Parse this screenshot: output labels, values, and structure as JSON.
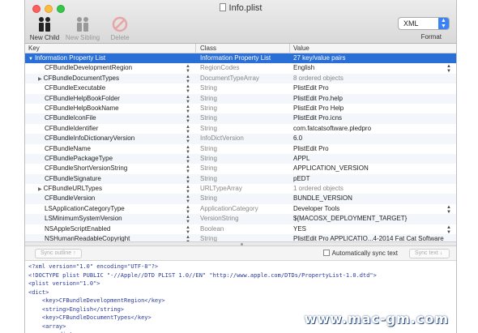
{
  "window": {
    "title": "Info.plist"
  },
  "toolbar": {
    "new_child": "New Child",
    "new_sibling": "New Sibling",
    "delete": "Delete",
    "format_value": "XML",
    "format_label": "Format"
  },
  "columns": {
    "key": "Key",
    "class": "Class",
    "value": "Value"
  },
  "rows": [
    {
      "key": "Information Property List",
      "class": "Information Property List",
      "value": "27 key/value pairs",
      "disclosure": "open",
      "selected": true
    },
    {
      "key": "CFBundleDevelopmentRegion",
      "class": "RegionCodes",
      "value": "English",
      "value_popup": true
    },
    {
      "key": "CFBundleDocumentTypes",
      "class": "DocumentTypeArray",
      "value": "8 ordered objects",
      "disclosure": "closed",
      "muted": true
    },
    {
      "key": "CFBundleExecutable",
      "class": "String",
      "value": "PlistEdit Pro"
    },
    {
      "key": "CFBundleHelpBookFolder",
      "class": "String",
      "value": "PlistEdit Pro.help"
    },
    {
      "key": "CFBundleHelpBookName",
      "class": "String",
      "value": "PlistEdit Pro Help"
    },
    {
      "key": "CFBundleIconFile",
      "class": "String",
      "value": "PlistEdit Pro.icns"
    },
    {
      "key": "CFBundleIdentifier",
      "class": "String",
      "value": "com.fatcatsoftware.pledpro"
    },
    {
      "key": "CFBundleInfoDictionaryVersion",
      "class": "InfoDictVersion",
      "value": "6.0"
    },
    {
      "key": "CFBundleName",
      "class": "String",
      "value": "PlistEdit Pro"
    },
    {
      "key": "CFBundlePackageType",
      "class": "String",
      "value": "APPL"
    },
    {
      "key": "CFBundleShortVersionString",
      "class": "String",
      "value": "APPLICATION_VERSION"
    },
    {
      "key": "CFBundleSignature",
      "class": "String",
      "value": "pEDT"
    },
    {
      "key": "CFBundleURLTypes",
      "class": "URLTypeArray",
      "value": "1 ordered objects",
      "disclosure": "closed",
      "muted": true
    },
    {
      "key": "CFBundleVersion",
      "class": "String",
      "value": "BUNDLE_VERSION"
    },
    {
      "key": "LSApplicationCategoryType",
      "class": "ApplicationCategory",
      "value": "Developer Tools",
      "value_popup": true
    },
    {
      "key": "LSMinimumSystemVersion",
      "class": "VersionString",
      "value": "${MACOSX_DEPLOYMENT_TARGET}"
    },
    {
      "key": "NSAppleScriptEnabled",
      "class": "Boolean",
      "value": "YES",
      "value_popup": true
    },
    {
      "key": "NSHumanReadableCopyright",
      "class": "String",
      "value": "PlistEdit Pro APPLICATIO...4-2014 Fat Cat Software"
    }
  ],
  "syncbar": {
    "sync_outline": "Sync outline ↑",
    "auto_sync": "Automatically sync text",
    "sync_text": "Sync text ↓"
  },
  "xml_lines": [
    "<?xml version=\"1.0\" encoding=\"UTF-8\"?>",
    "<!DOCTYPE plist PUBLIC \"-//Apple//DTD PLIST 1.0//EN\" \"http://www.apple.com/DTDs/PropertyList-1.0.dtd\">",
    "<plist version=\"1.0\">",
    "<dict>",
    "    <key>CFBundleDevelopmentRegion</key>",
    "    <string>English</string>",
    "    <key>CFBundleDocumentTypes</key>",
    "    <array>",
    "        <dict>"
  ],
  "watermark": "www.mac-gm.com",
  "colors": {
    "selection": "#2a6fd6",
    "alt_row": "#f3f6fa",
    "format_accent": "#3b82f6"
  }
}
